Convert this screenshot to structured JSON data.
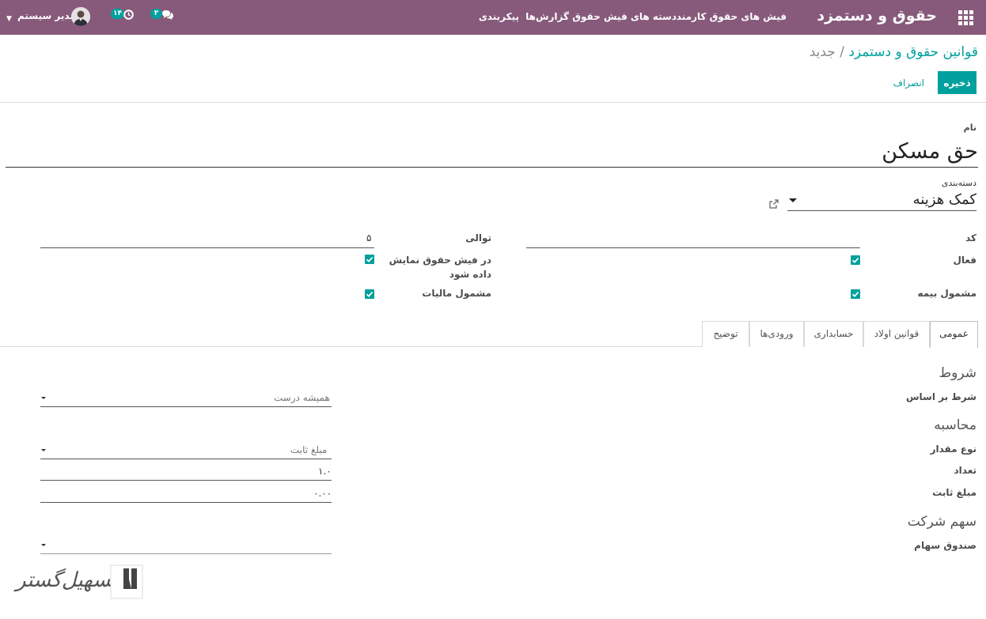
{
  "navbar": {
    "app_title": "حقوق و دستمزد",
    "menu": [
      "فیش های حقوق کارمند",
      "دسته های فیش حقوق",
      "گزارش‌ها",
      "پیکربندی"
    ],
    "messages_count": "۳",
    "activities_count": "۱۴",
    "user_name": "مدیر سیستم"
  },
  "breadcrumb": {
    "parent": "قوانین حقوق و دستمزد",
    "separator": "/",
    "current": "جدید"
  },
  "buttons": {
    "save": "ذخیره",
    "discard": "انصراف"
  },
  "form": {
    "name_label": "نام",
    "name_value": "حق مسکن",
    "category_label": "دسته‌بندی",
    "category_value": "کمک هزینه",
    "code_label": "کد",
    "code_value": "",
    "sequence_label": "توالی",
    "sequence_value": "۵",
    "active_label": "فعال",
    "active_checked": true,
    "appears_on_payslip_label": "در فیش حقوق نمایش داده شود",
    "appears_on_payslip_label_l1": "در فیش حقوق نمایش",
    "appears_on_payslip_label_l2": "داده شود",
    "appears_on_payslip_checked": true,
    "insurance_label": "مشمول بیمه",
    "insurance_checked": true,
    "tax_label": "مشمول مالیات",
    "tax_checked": true
  },
  "tabs": [
    "عمومی",
    "قوانین اولاد",
    "حسابداری",
    "ورودی‌ها",
    "توضیح"
  ],
  "active_tab": "عمومی",
  "general": {
    "conditions_title": "شروط",
    "condition_based_on_label": "شرط بر اساس",
    "condition_based_on_value": "همیشه درست",
    "computation_title": "محاسبه",
    "amount_type_label": "نوع مقدار",
    "amount_type_value": "مبلغ ثابت",
    "quantity_label": "تعداد",
    "quantity_value": "۱.۰",
    "fixed_amount_label": "مبلغ ثابت",
    "fixed_amount_value": "۰.۰۰",
    "company_contribution_title": "سهم شرکت",
    "contribution_fund_label": "صندوق سهام",
    "contribution_fund_value": ""
  },
  "watermark": {
    "text": "تسهیل‌گستر"
  },
  "colors": {
    "navbar": "#875a7b",
    "accent": "#00a09d"
  },
  "icons": [
    "apps-grid-icon",
    "chat-icon",
    "clock-icon",
    "user-avatar",
    "external-link-icon",
    "caret-down-icon",
    "checkbox-checked-icon"
  ]
}
